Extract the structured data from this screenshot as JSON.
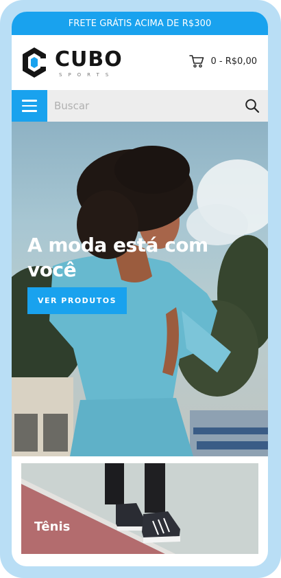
{
  "promo": {
    "text": "FRETE GRÁTIS ACIMA DE R$300"
  },
  "brand": {
    "name": "CUBO",
    "tagline": "SPORTS"
  },
  "cart": {
    "summary": "0 - R$0,00",
    "icon": "cart-icon"
  },
  "search": {
    "placeholder": "Buscar",
    "value": "",
    "icon": "search-icon"
  },
  "menu": {
    "icon": "hamburger-menu-icon"
  },
  "hero": {
    "title": "A moda está com você",
    "button_label": "VER PRODUTOS"
  },
  "category": {
    "label": "Tênis"
  },
  "colors": {
    "accent": "#19a2ee",
    "frame": "#b9def5",
    "search_bg": "#ededed",
    "text_dark": "#151515"
  }
}
